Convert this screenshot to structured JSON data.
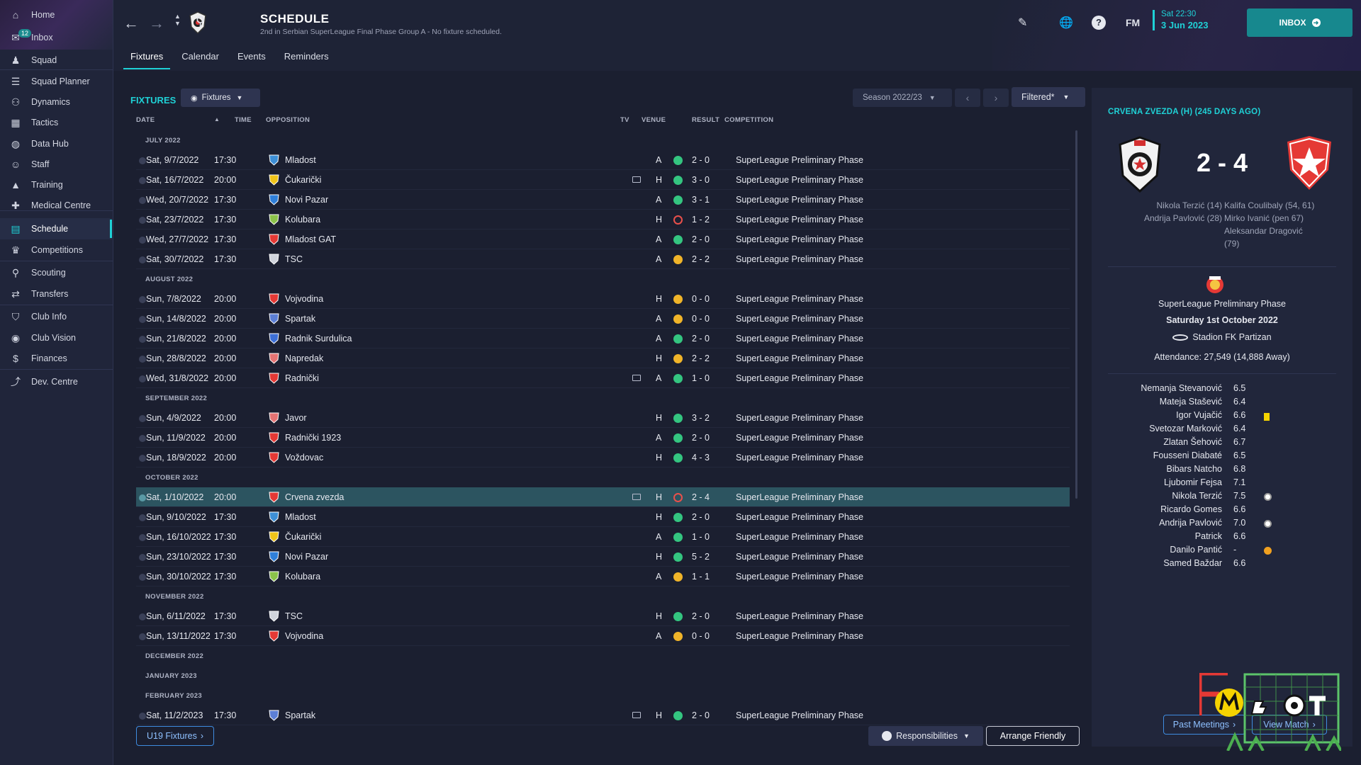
{
  "sidebar": {
    "items": [
      {
        "label": "Home",
        "icon": "home-icon"
      },
      {
        "label": "Inbox",
        "icon": "inbox-icon",
        "badge": "12"
      },
      {
        "label": "Squad",
        "icon": "squad-icon"
      },
      {
        "label": "Squad Planner",
        "icon": "planner-icon"
      },
      {
        "label": "Dynamics",
        "icon": "dynamics-icon"
      },
      {
        "label": "Tactics",
        "icon": "tactics-icon"
      },
      {
        "label": "Data Hub",
        "icon": "data-hub-icon"
      },
      {
        "label": "Staff",
        "icon": "staff-icon"
      },
      {
        "label": "Training",
        "icon": "training-icon"
      },
      {
        "label": "Medical Centre",
        "icon": "medical-icon"
      },
      {
        "label": "Schedule",
        "icon": "calendar-icon",
        "active": true
      },
      {
        "label": "Competitions",
        "icon": "trophy-icon"
      },
      {
        "label": "Scouting",
        "icon": "scouting-icon"
      },
      {
        "label": "Transfers",
        "icon": "transfers-icon"
      },
      {
        "label": "Club Info",
        "icon": "shield-icon"
      },
      {
        "label": "Club Vision",
        "icon": "vision-icon"
      },
      {
        "label": "Finances",
        "icon": "finances-icon"
      },
      {
        "label": "Dev. Centre",
        "icon": "dev-centre-icon"
      }
    ]
  },
  "header": {
    "title": "SCHEDULE",
    "subtitle": "2nd in Serbian SuperLeague Final Phase Group A - No fixture scheduled.",
    "fm_label": "FM",
    "date_time": "Sat 22:30",
    "date_day": "3 Jun 2023",
    "inbox_label": "INBOX",
    "tabs": [
      "Fixtures",
      "Calendar",
      "Events",
      "Reminders"
    ]
  },
  "fixtures": {
    "title": "FIXTURES",
    "view_dropdown": "Fixtures",
    "season": "Season 2022/23",
    "filter": "Filtered*",
    "columns": {
      "date": "DATE",
      "time": "TIME",
      "opposition": "OPPOSITION",
      "tv": "TV",
      "venue": "VENUE",
      "result": "RESULT",
      "competition": "COMPETITION"
    },
    "rows": [
      {
        "type": "month",
        "label": "JULY 2022"
      },
      {
        "date": "Sat, 9/7/2022",
        "time": "17:30",
        "opp": "Mladost",
        "tv": false,
        "venue": "A",
        "res": "w",
        "score": "2 - 0",
        "comp": "SuperLeague Preliminary Phase",
        "crest": "#3d8fd6"
      },
      {
        "date": "Sat, 16/7/2022",
        "time": "20:00",
        "opp": "Čukarički",
        "tv": true,
        "venue": "H",
        "res": "w",
        "score": "3 - 0",
        "comp": "SuperLeague Preliminary Phase",
        "crest": "#f0c419"
      },
      {
        "date": "Wed, 20/7/2022",
        "time": "17:30",
        "opp": "Novi Pazar",
        "tv": false,
        "venue": "A",
        "res": "w",
        "score": "3 - 1",
        "comp": "SuperLeague Preliminary Phase",
        "crest": "#2f7fd9"
      },
      {
        "date": "Sat, 23/7/2022",
        "time": "17:30",
        "opp": "Kolubara",
        "tv": false,
        "venue": "H",
        "res": "l",
        "score": "1 - 2",
        "comp": "SuperLeague Preliminary Phase",
        "crest": "#8bc34a"
      },
      {
        "date": "Wed, 27/7/2022",
        "time": "17:30",
        "opp": "Mladost GAT",
        "tv": false,
        "venue": "A",
        "res": "w",
        "score": "2 - 0",
        "comp": "SuperLeague Preliminary Phase",
        "crest": "#e53935"
      },
      {
        "date": "Sat, 30/7/2022",
        "time": "17:30",
        "opp": "TSC",
        "tv": false,
        "venue": "A",
        "res": "d",
        "score": "2 - 2",
        "comp": "SuperLeague Preliminary Phase",
        "crest": "#d0d4dc"
      },
      {
        "type": "month",
        "label": "AUGUST 2022"
      },
      {
        "date": "Sun, 7/8/2022",
        "time": "20:00",
        "opp": "Vojvodina",
        "tv": false,
        "venue": "H",
        "res": "d",
        "score": "0 - 0",
        "comp": "SuperLeague Preliminary Phase",
        "crest": "#e53935"
      },
      {
        "date": "Sun, 14/8/2022",
        "time": "20:00",
        "opp": "Spartak",
        "tv": false,
        "venue": "A",
        "res": "d",
        "score": "0 - 0",
        "comp": "SuperLeague Preliminary Phase",
        "crest": "#5c7fd6"
      },
      {
        "date": "Sun, 21/8/2022",
        "time": "20:00",
        "opp": "Radnik Surdulica",
        "tv": false,
        "venue": "A",
        "res": "w",
        "score": "2 - 0",
        "comp": "SuperLeague Preliminary Phase",
        "crest": "#3d6fd6"
      },
      {
        "date": "Sun, 28/8/2022",
        "time": "20:00",
        "opp": "Napredak",
        "tv": false,
        "venue": "H",
        "res": "d",
        "score": "2 - 2",
        "comp": "SuperLeague Preliminary Phase",
        "crest": "#e57373"
      },
      {
        "date": "Wed, 31/8/2022",
        "time": "20:00",
        "opp": "Radnički",
        "tv": true,
        "venue": "A",
        "res": "w",
        "score": "1 - 0",
        "comp": "SuperLeague Preliminary Phase",
        "crest": "#e53935"
      },
      {
        "type": "month",
        "label": "SEPTEMBER 2022"
      },
      {
        "date": "Sun, 4/9/2022",
        "time": "20:00",
        "opp": "Javor",
        "tv": false,
        "venue": "H",
        "res": "w",
        "score": "3 - 2",
        "comp": "SuperLeague Preliminary Phase",
        "crest": "#e57373"
      },
      {
        "date": "Sun, 11/9/2022",
        "time": "20:00",
        "opp": "Radnički 1923",
        "tv": false,
        "venue": "A",
        "res": "w",
        "score": "2 - 0",
        "comp": "SuperLeague Preliminary Phase",
        "crest": "#e53935"
      },
      {
        "date": "Sun, 18/9/2022",
        "time": "20:00",
        "opp": "Voždovac",
        "tv": false,
        "venue": "H",
        "res": "w",
        "score": "4 - 3",
        "comp": "SuperLeague Preliminary Phase",
        "crest": "#e53935"
      },
      {
        "type": "month",
        "label": "OCTOBER 2022"
      },
      {
        "date": "Sat, 1/10/2022",
        "time": "20:00",
        "opp": "Crvena zvezda",
        "tv": true,
        "venue": "H",
        "res": "l",
        "score": "2 - 4",
        "comp": "SuperLeague Preliminary Phase",
        "crest": "#e53935",
        "selected": true
      },
      {
        "date": "Sun, 9/10/2022",
        "time": "17:30",
        "opp": "Mladost",
        "tv": false,
        "venue": "H",
        "res": "w",
        "score": "2 - 0",
        "comp": "SuperLeague Preliminary Phase",
        "crest": "#3d8fd6"
      },
      {
        "date": "Sun, 16/10/2022",
        "time": "17:30",
        "opp": "Čukarički",
        "tv": false,
        "venue": "A",
        "res": "w",
        "score": "1 - 0",
        "comp": "SuperLeague Preliminary Phase",
        "crest": "#f0c419"
      },
      {
        "date": "Sun, 23/10/2022",
        "time": "17:30",
        "opp": "Novi Pazar",
        "tv": false,
        "venue": "H",
        "res": "w",
        "score": "5 - 2",
        "comp": "SuperLeague Preliminary Phase",
        "crest": "#2f7fd9"
      },
      {
        "date": "Sun, 30/10/2022",
        "time": "17:30",
        "opp": "Kolubara",
        "tv": false,
        "venue": "A",
        "res": "d",
        "score": "1 - 1",
        "comp": "SuperLeague Preliminary Phase",
        "crest": "#8bc34a"
      },
      {
        "type": "month",
        "label": "NOVEMBER 2022"
      },
      {
        "date": "Sun, 6/11/2022",
        "time": "17:30",
        "opp": "TSC",
        "tv": false,
        "venue": "H",
        "res": "w",
        "score": "2 - 0",
        "comp": "SuperLeague Preliminary Phase",
        "crest": "#d0d4dc"
      },
      {
        "date": "Sun, 13/11/2022",
        "time": "17:30",
        "opp": "Vojvodina",
        "tv": false,
        "venue": "A",
        "res": "d",
        "score": "0 - 0",
        "comp": "SuperLeague Preliminary Phase",
        "crest": "#e53935"
      },
      {
        "type": "month",
        "label": "DECEMBER 2022"
      },
      {
        "type": "month",
        "label": "JANUARY 2023"
      },
      {
        "type": "month",
        "label": "FEBRUARY 2023"
      },
      {
        "date": "Sat, 11/2/2023",
        "time": "17:30",
        "opp": "Spartak",
        "tv": true,
        "venue": "H",
        "res": "w",
        "score": "2 - 0",
        "comp": "SuperLeague Preliminary Phase",
        "crest": "#5c7fd6"
      }
    ],
    "u19_button": "U19 Fixtures",
    "responsibilities_button": "Responsibilities",
    "arrange_friendly_button": "Arrange Friendly"
  },
  "match_panel": {
    "title": "CRVENA ZVEZDA (H) (245 DAYS AGO)",
    "score": "2 - 4",
    "home_scorers": [
      "Nikola Terzić (14)",
      "Andrija Pavlović (28)"
    ],
    "away_scorers": [
      "Kalifa Coulibaly (54, 61)",
      "Mirko Ivanić (pen 67)",
      "Aleksandar Dragović",
      "(79)"
    ],
    "competition": "SuperLeague Preliminary Phase",
    "date": "Saturday 1st October 2022",
    "stadium": "Stadion FK Partizan",
    "attendance": "Attendance: 27,549 (14,888 Away)",
    "players": [
      {
        "name": "Nemanja Stevanović",
        "rating": "6.5",
        "icon": ""
      },
      {
        "name": "Mateja Stašević",
        "rating": "6.4",
        "icon": ""
      },
      {
        "name": "Igor Vujačić",
        "rating": "6.6",
        "icon": "yellow-card-icon"
      },
      {
        "name": "Svetozar Marković",
        "rating": "6.4",
        "icon": ""
      },
      {
        "name": "Zlatan Šehović",
        "rating": "6.7",
        "icon": ""
      },
      {
        "name": "Fousseni Diabaté",
        "rating": "6.5",
        "icon": ""
      },
      {
        "name": "Bibars Natcho",
        "rating": "6.8",
        "icon": ""
      },
      {
        "name": "Ljubomir Fejsa",
        "rating": "7.1",
        "icon": ""
      },
      {
        "name": "Nikola Terzić",
        "rating": "7.5",
        "icon": "goal-icon"
      },
      {
        "name": "Ricardo Gomes",
        "rating": "6.6",
        "icon": ""
      },
      {
        "name": "Andrija Pavlović",
        "rating": "7.0",
        "icon": "goal-icon"
      },
      {
        "name": "Patrick",
        "rating": "6.6",
        "icon": ""
      },
      {
        "name": "Danilo Pantić",
        "rating": "-",
        "icon": "substitute-icon"
      },
      {
        "name": "Samed Baždar",
        "rating": "6.6",
        "icon": ""
      }
    ],
    "past_meetings_button": "Past Meetings",
    "view_match_button": "View Match"
  },
  "colors": {
    "accent": "#1fd1d6",
    "win": "#34c580",
    "loss": "#e9504b",
    "draw": "#f0b429",
    "selected_row": "#2c5460"
  }
}
